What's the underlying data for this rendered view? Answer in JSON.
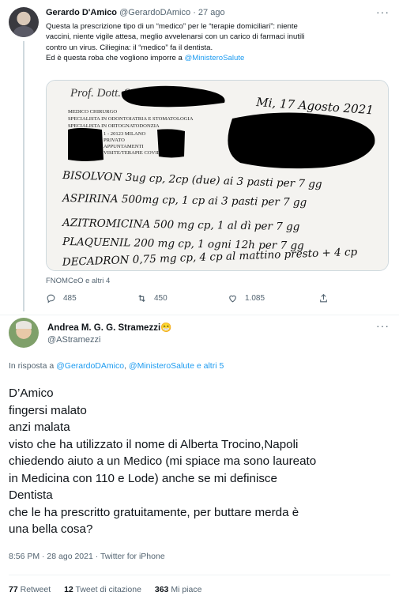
{
  "quoted_tweet": {
    "display_name": "Gerardo D'Amico",
    "handle": "@GerardoDAmico",
    "separator": "·",
    "date": "27 ago",
    "text_lines": [
      "Questa la prescrizione tipo di un “medico” per le “terapie domiciliari”: niente",
      "vaccini, niente vigile attesa, meglio avvelenarsi con un carico di farmaci inutili",
      "contro un virus. Ciliegina: il “medico” fa il dentista."
    ],
    "last_line_prefix": "Ed è questa roba che vogliono imporre a ",
    "last_line_mention": "@MinisteroSalute",
    "media": {
      "header_stamp": "Prof. Dott. S",
      "stamp_lines": [
        "MEDICO CHIRURGO",
        "SPECIALISTA IN ODONTOIATRIA E STOMATOLOGIA",
        "SPECIALISTA IN ORTOGNATODONZIA",
        "1 - 20123 MILANO",
        "PRIVATO",
        "APPUNTAMENTI",
        "VISITE/TERAPIE COVID 19"
      ],
      "date_handwritten": "Mi, 17 Agosto 2021",
      "handwritten_lines": [
        "BISOLVON 3ug cp, 2cp (due) ai 3 pasti per 7 gg",
        "ASPIRINA 500mg cp, 1 cp ai 3 pasti per 7 gg",
        "AZITROMICINA 500 mg cp, 1 al dì per 7 gg",
        "PLAQUENIL 200 mg cp, 1 ogni 12h per 7 gg",
        "DECADRON 0,75 mg cp, 4 cp al mattino presto + 4 cp"
      ]
    },
    "tagged": "FNOMCeO e altri 4",
    "actions": {
      "replies": "485",
      "retweets": "450",
      "likes": "1.085"
    },
    "icons": [
      "reply-icon",
      "retweet-icon",
      "heart-icon",
      "share-icon",
      "more-icon"
    ]
  },
  "tweet": {
    "display_name": "Andrea M. G. G. Stramezzi",
    "emoji": "😁",
    "handle": "@AStramezzi",
    "reply_prefix": "In risposta a ",
    "reply_mention_1": "@GerardoDAmico",
    "reply_sep": ", ",
    "reply_mention_2": "@MinisteroSalute",
    "reply_suffix": " e altri 5",
    "body_lines": [
      "D’Amico",
      "fingersi malato",
      "anzi malata",
      "visto che ha utilizzato il nome di Alberta Trocino,Napoli",
      "chiedendo aiuto a un Medico (mi spiace ma sono laureato",
      "in Medicina con 110 e Lode) anche se mi definisce",
      "Dentista",
      "che le ha prescritto gratuitamente, per buttare merda è",
      "una bella cosa?"
    ],
    "time": "8:56 PM · 28 ago 2021 · Twitter for iPhone",
    "stats": {
      "retweets_count": "77",
      "retweets_label": "Retweet",
      "quotes_count": "12",
      "quotes_label": "Tweet di citazione",
      "likes_count": "363",
      "likes_label": "Mi piace"
    }
  },
  "colors": {
    "text": "#0f1419",
    "muted": "#536471",
    "link": "#1d9bf0",
    "divider": "#eff3f4",
    "thread_line": "#cfd9de"
  }
}
